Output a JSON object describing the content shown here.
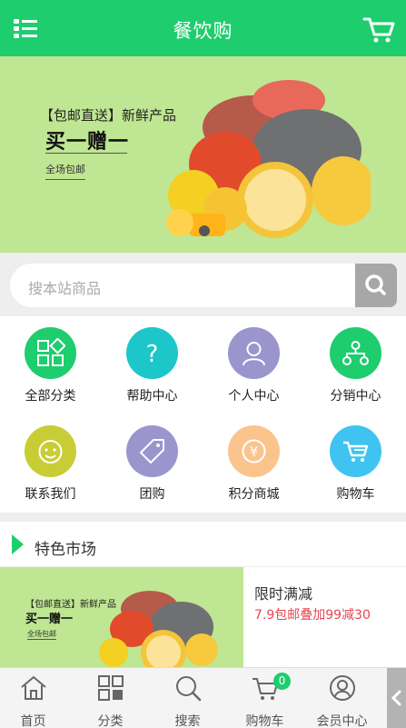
{
  "header": {
    "title": "餐饮购",
    "menu_icon": "list-menu-icon",
    "cart_icon": "cart-icon",
    "accent": "#1ecd6e"
  },
  "banner": {
    "headline": "【包邮直送】新鲜产品",
    "subline": "买一赠一",
    "shipping": "全场包邮"
  },
  "search": {
    "placeholder": "搜本站商品",
    "icon": "search-icon"
  },
  "categories": [
    {
      "label": "全部分类",
      "color": "#1ecd6e",
      "icon": "grid-icon"
    },
    {
      "label": "帮助中心",
      "color": "#1dc6c9",
      "icon": "question-icon"
    },
    {
      "label": "个人中心",
      "color": "#9a95cd",
      "icon": "user-icon"
    },
    {
      "label": "分销中心",
      "color": "#1ecd6e",
      "icon": "network-icon"
    },
    {
      "label": "联系我们",
      "color": "#c8cd35",
      "icon": "smiley-icon"
    },
    {
      "label": "团购",
      "color": "#9a95cd",
      "icon": "tag-icon"
    },
    {
      "label": "积分商城",
      "color": "#fbc48d",
      "icon": "yen-icon"
    },
    {
      "label": "购物车",
      "color": "#3fc4f1",
      "icon": "cart-icon"
    }
  ],
  "section": {
    "title": "特色市场",
    "promo": {
      "headline": "【包邮直送】新鲜产品",
      "subline": "买一赠一",
      "shipping": "全场包邮"
    },
    "deal": {
      "title": "限时满减",
      "subtitle": "7.9包邮叠加99减30"
    }
  },
  "tabbar": {
    "items": [
      {
        "label": "首页",
        "icon": "home-icon"
      },
      {
        "label": "分类",
        "icon": "category-grid-icon"
      },
      {
        "label": "搜索",
        "icon": "search-icon"
      },
      {
        "label": "购物车",
        "icon": "cart-icon",
        "badge": "0"
      },
      {
        "label": "会员中心",
        "icon": "user-icon"
      }
    ]
  }
}
